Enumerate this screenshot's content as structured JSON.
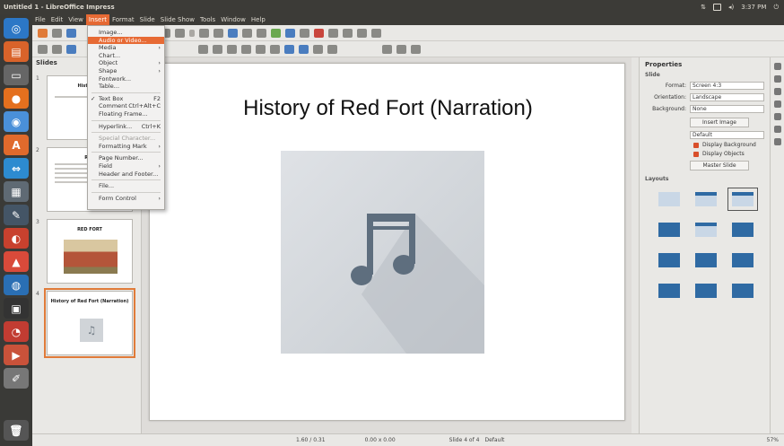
{
  "window": {
    "title": "Untitled 1 - LibreOffice Impress"
  },
  "topbar": {
    "time": "3:37 PM"
  },
  "menubar": [
    "File",
    "Edit",
    "View",
    "Insert",
    "Format",
    "Slide",
    "Slide Show",
    "Tools",
    "Window",
    "Help"
  ],
  "insert_menu": {
    "items": [
      {
        "label": "Image...",
        "kind": "item"
      },
      {
        "label": "Audio or Video...",
        "kind": "highlighted"
      },
      {
        "label": "Media",
        "kind": "submenu"
      },
      {
        "label": "Chart...",
        "kind": "item"
      },
      {
        "label": "Object",
        "kind": "submenu"
      },
      {
        "label": "Shape",
        "kind": "submenu"
      },
      {
        "label": "Fontwork...",
        "kind": "item"
      },
      {
        "label": "Table...",
        "kind": "item"
      },
      {
        "kind": "separator"
      },
      {
        "label": "Text Box",
        "kind": "checked",
        "shortcut": "F2"
      },
      {
        "label": "Comment",
        "kind": "item",
        "shortcut": "Ctrl+Alt+C"
      },
      {
        "label": "Floating Frame...",
        "kind": "item"
      },
      {
        "kind": "separator"
      },
      {
        "label": "Hyperlink...",
        "kind": "item",
        "shortcut": "Ctrl+K"
      },
      {
        "kind": "separator"
      },
      {
        "label": "Special Character...",
        "kind": "disabled"
      },
      {
        "label": "Formatting Mark",
        "kind": "submenu"
      },
      {
        "kind": "separator"
      },
      {
        "label": "Page Number...",
        "kind": "item"
      },
      {
        "label": "Field",
        "kind": "submenu"
      },
      {
        "label": "Header and Footer...",
        "kind": "item"
      },
      {
        "kind": "separator"
      },
      {
        "label": "File...",
        "kind": "item"
      },
      {
        "kind": "separator"
      },
      {
        "label": "Form Control",
        "kind": "submenu"
      }
    ]
  },
  "slides_pane": {
    "header": "Slides",
    "slides": [
      {
        "number": "1",
        "title": "Historical"
      },
      {
        "number": "2",
        "title": "RED"
      },
      {
        "number": "3",
        "title": "RED FORT"
      },
      {
        "number": "4",
        "title": "History of Red Fort (Narration)"
      }
    ]
  },
  "slide": {
    "title": "History of Red Fort (Narration)"
  },
  "properties": {
    "header": "Properties",
    "slide_section": "Slide",
    "format_label": "Format:",
    "format_value": "Screen 4:3",
    "orientation_label": "Orientation:",
    "orientation_value": "Landscape",
    "background_label": "Background:",
    "background_value": "None",
    "insert_image_button": "Insert Image",
    "master_value": "Default",
    "display_background": "Display Background",
    "display_objects": "Display Objects",
    "master_slide_button": "Master Slide",
    "layouts_section": "Layouts"
  },
  "statusbar": {
    "position": "1.60 / 0.31",
    "size": "0.00 x 0.00",
    "slide_info": "Slide 4 of 4",
    "master": "Default",
    "zoom": "57%"
  },
  "colors": {
    "accent": "#e76a34",
    "launcher_bg": "#3a3a37",
    "layout_blue": "#2f6aa3"
  }
}
